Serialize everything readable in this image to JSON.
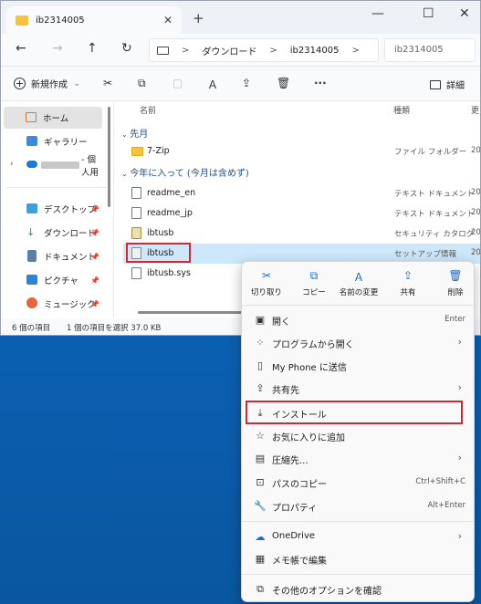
{
  "window": {
    "tab_title": "ib2314005",
    "tab_close": "✕",
    "new_tab": "+",
    "minimize": "—",
    "maximize": "☐",
    "close": "✕"
  },
  "address": {
    "back": "←",
    "forward": "→",
    "up": "↑",
    "refresh": "↻",
    "breadcrumb": [
      "ダウンロード",
      "ib2314005"
    ],
    "sep": ">",
    "search_placeholder": "ib2314005"
  },
  "toolbar": {
    "new_label": "新規作成",
    "new_chevron": "⌄",
    "more": "···",
    "details_label": "詳細"
  },
  "sidebar": {
    "items": [
      {
        "label": "ホーム",
        "selected": true,
        "pinned": false
      },
      {
        "label": "ギャラリー",
        "selected": false,
        "pinned": false
      },
      {
        "label": "- 個人用",
        "selected": false,
        "pinned": false
      },
      {
        "label": "デスクトップ",
        "selected": false,
        "pinned": true
      },
      {
        "label": "ダウンロード",
        "selected": false,
        "pinned": true
      },
      {
        "label": "ドキュメント",
        "selected": false,
        "pinned": true
      },
      {
        "label": "ピクチャ",
        "selected": false,
        "pinned": true
      },
      {
        "label": "ミュージック",
        "selected": false,
        "pinned": true
      }
    ],
    "pin_glyph": "📌"
  },
  "filelist": {
    "headers": {
      "name": "名前",
      "type": "種類",
      "date": "更"
    },
    "groups": [
      {
        "label": "先月"
      },
      {
        "label": "今年に入って (今月は含めず)"
      }
    ],
    "rows": [
      {
        "name": "7-Zip",
        "type": "ファイル フォルダー",
        "date": "20"
      },
      {
        "name": "readme_en",
        "type": "テキスト ドキュメント",
        "date": "20"
      },
      {
        "name": "readme_jp",
        "type": "テキスト ドキュメント",
        "date": "20"
      },
      {
        "name": "ibtusb",
        "type": "セキュリティ カタログ",
        "date": "20"
      },
      {
        "name": "ibtusb",
        "type": "セットアップ情報",
        "date": "20"
      },
      {
        "name": "ibtusb.sys",
        "type": "",
        "date": ""
      }
    ]
  },
  "status": {
    "count": "6 個の項目",
    "selection": "1 個の項目を選択  37.0 KB"
  },
  "context_menu": {
    "quick_actions": [
      {
        "icon": "cut-icon",
        "glyph": "✂",
        "label": "切り取り"
      },
      {
        "icon": "copy-icon",
        "glyph": "⧉",
        "label": "コピー"
      },
      {
        "icon": "rename-icon",
        "glyph": "Ａ",
        "label": "名前の変更"
      },
      {
        "icon": "share-icon",
        "glyph": "⇪",
        "label": "共有"
      },
      {
        "icon": "delete-icon",
        "glyph": "🗑",
        "label": "削除"
      }
    ],
    "items": [
      {
        "label": "開く",
        "shortcut": "Enter",
        "arrow": "",
        "glyph": "▣"
      },
      {
        "label": "プログラムから開く",
        "shortcut": "",
        "arrow": "›",
        "glyph": "⁘"
      },
      {
        "label": "My Phone に送信",
        "shortcut": "",
        "arrow": "",
        "glyph": "▯"
      },
      {
        "label": "共有先",
        "shortcut": "",
        "arrow": "›",
        "glyph": "⇪"
      },
      {
        "label": "インストール",
        "shortcut": "",
        "arrow": "",
        "glyph": "⤓"
      },
      {
        "label": "お気に入りに追加",
        "shortcut": "",
        "arrow": "",
        "glyph": "☆"
      },
      {
        "label": "圧縮先...",
        "shortcut": "",
        "arrow": "›",
        "glyph": "▤"
      },
      {
        "label": "パスのコピー",
        "shortcut": "Ctrl+Shift+C",
        "arrow": "",
        "glyph": "⊡"
      },
      {
        "label": "プロパティ",
        "shortcut": "Alt+Enter",
        "arrow": "",
        "glyph": "🔧"
      },
      {
        "label": "OneDrive",
        "shortcut": "",
        "arrow": "›",
        "glyph": "☁"
      },
      {
        "label": "メモ帳で編集",
        "shortcut": "",
        "arrow": "",
        "glyph": "▦"
      },
      {
        "label": "その他のオプションを確認",
        "shortcut": "",
        "arrow": "",
        "glyph": "⧉"
      }
    ]
  },
  "colors": {
    "accent": "#1a6ac9",
    "highlight": "#d8262f",
    "selection": "#cde8fb"
  }
}
